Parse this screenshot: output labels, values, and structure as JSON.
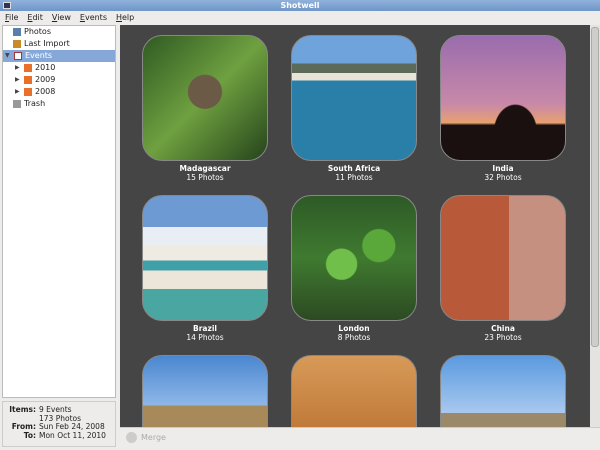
{
  "window": {
    "title": "Shotwell"
  },
  "menu": [
    "File",
    "Edit",
    "View",
    "Events",
    "Help"
  ],
  "sidebar": {
    "photos": "Photos",
    "last_import": "Last Import",
    "events": "Events",
    "years": [
      "2010",
      "2009",
      "2008"
    ],
    "trash": "Trash"
  },
  "info": {
    "items_label": "Items:",
    "items": "9 Events",
    "photos": "173 Photos",
    "from_label": "From:",
    "from": "Sun Feb 24, 2008",
    "to_label": "To:",
    "to": "Mon Oct 11, 2010"
  },
  "toolbar": {
    "merge": "Merge"
  },
  "events": [
    {
      "name": "Madagascar",
      "count": "15 Photos"
    },
    {
      "name": "South Africa",
      "count": "11 Photos"
    },
    {
      "name": "India",
      "count": "32 Photos"
    },
    {
      "name": "Brazil",
      "count": "14 Photos"
    },
    {
      "name": "London",
      "count": "8 Photos"
    },
    {
      "name": "China",
      "count": "23 Photos"
    },
    {
      "name": "",
      "count": ""
    },
    {
      "name": "",
      "count": ""
    },
    {
      "name": "",
      "count": ""
    }
  ]
}
